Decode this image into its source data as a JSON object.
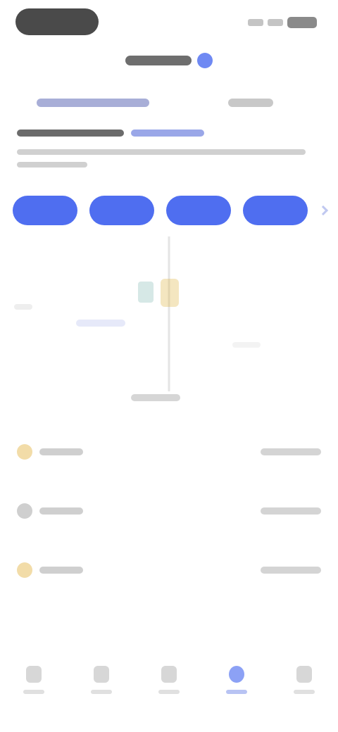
{
  "status_bar": {
    "time": "",
    "icons": [
      "signal-icon",
      "wifi-icon",
      "battery-icon"
    ]
  },
  "nav": {
    "title": "",
    "verified_icon": "verified-badge-icon"
  },
  "tabs": [
    {
      "label": "",
      "active": true
    },
    {
      "label": "",
      "active": false
    }
  ],
  "summary": {
    "headline": "",
    "change": "",
    "description": ""
  },
  "actions": [
    {
      "label": ""
    },
    {
      "label": ""
    },
    {
      "label": ""
    },
    {
      "label": ""
    }
  ],
  "chart": {
    "caption": "",
    "colors": [
      "#5ba59a",
      "#e0b84a",
      "#9aa7e8"
    ]
  },
  "assets": [
    {
      "name": "",
      "value": "",
      "icon_color": "#e8c060"
    },
    {
      "name": "",
      "value": "",
      "icon_color": "#a8a8a8"
    },
    {
      "name": "",
      "value": "",
      "icon_color": "#e8c060"
    }
  ],
  "tabbar": [
    {
      "label": "",
      "icon": "home-icon",
      "active": false
    },
    {
      "label": "",
      "icon": "chart-icon",
      "active": false
    },
    {
      "label": "",
      "icon": "swap-icon",
      "active": false
    },
    {
      "label": "",
      "icon": "wallet-icon",
      "active": true
    },
    {
      "label": "",
      "icon": "profile-icon",
      "active": false
    }
  ],
  "colors": {
    "accent": "#4f6ef0",
    "text": "#222222"
  }
}
